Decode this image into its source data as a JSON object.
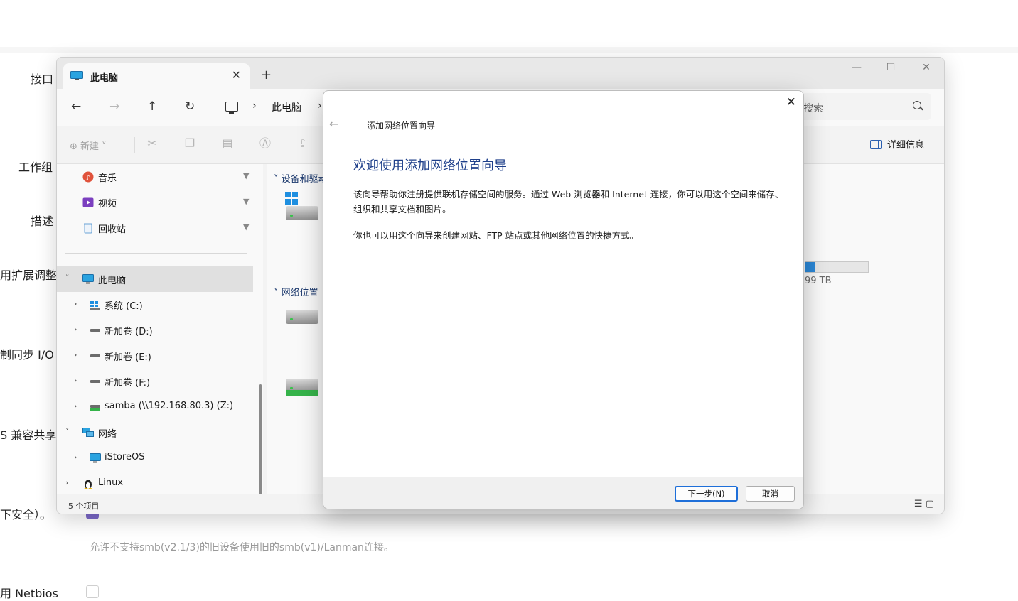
{
  "background": {
    "labels": {
      "interface": "接口",
      "workgroup": "工作组",
      "description": "描述",
      "extend": "用扩展调整",
      "sync_io": "制同步 I/O",
      "compat_share": "S 兼容共享",
      "insecure": "下安全）。",
      "netbios": "用 Netbios"
    },
    "help_text": "允许不支持smb(v2.1/3)的旧设备使用旧的smb(v1)/Lanman连接。"
  },
  "explorer": {
    "tab_title": "此电脑",
    "tab_close": "✕",
    "new_tab": "+",
    "window_buttons": {
      "minimize": "—",
      "maximize": "☐",
      "close": "✕"
    },
    "nav": {
      "back": "←",
      "forward": "→",
      "up": "↑",
      "refresh": "↻"
    },
    "address": {
      "sep1": "›",
      "path": "此电脑",
      "sep2": "›"
    },
    "search_placeholder": "搜索",
    "commands": {
      "new_label": "⊕ 新建 ˅",
      "details_label": "详细信息"
    },
    "sidebar": {
      "quick": [
        {
          "label": "音乐",
          "icon": "music-icon",
          "color": "#e0523b"
        },
        {
          "label": "视频",
          "icon": "video-icon",
          "color": "#7b3fbf"
        },
        {
          "label": "回收站",
          "icon": "recycle-bin-icon",
          "color": "#6aa3d6"
        }
      ],
      "pin_glyph": "📌",
      "this_pc": "此电脑",
      "drives": [
        {
          "label": "系统 (C:)",
          "icon": "windows-drive-icon"
        },
        {
          "label": "新加卷 (D:)",
          "icon": "drive-icon"
        },
        {
          "label": "新加卷 (E:)",
          "icon": "drive-icon"
        },
        {
          "label": "新加卷 (F:)",
          "icon": "drive-icon"
        },
        {
          "label": "samba (\\\\192.168.80.3) (Z:)",
          "icon": "network-drive-icon"
        }
      ],
      "network": "网络",
      "network_children": [
        {
          "label": "iStoreOS",
          "icon": "computer-icon"
        }
      ],
      "linux": "Linux"
    },
    "content": {
      "group_devices": "设备和驱动",
      "group_network": "网络位置",
      "capacity_text": "99 TB",
      "capacity_fraction": 0.16
    },
    "status": {
      "count": "5 个项目",
      "view_icons": "☰ ▢"
    }
  },
  "wizard": {
    "close": "✕",
    "back": "←",
    "title": "添加网络位置向导",
    "heading": "欢迎使用添加网络位置向导",
    "para1": "该向导帮助你注册提供联机存储空间的服务。通过 Web 浏览器和 Internet 连接，你可以用这个空间来储存、组织和共享文档和图片。",
    "para2": "你也可以用这个向导来创建网站、FTP 站点或其他网络位置的快捷方式。",
    "next_button": "下一步(N)",
    "cancel_button": "取消"
  }
}
